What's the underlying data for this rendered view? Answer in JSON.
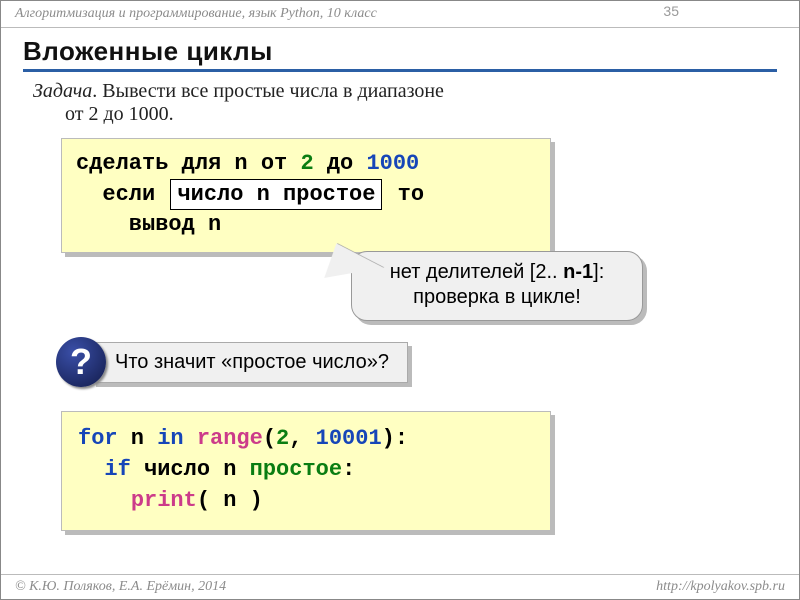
{
  "header": {
    "subject": "Алгоритмизация и программирование, язык Python, 10 класс",
    "page_number": "35"
  },
  "title": "Вложенные циклы",
  "task": {
    "label": "Задача",
    "text_line1": ". Вывести все простые числа в диапазоне",
    "text_line2": "от 2 до 1000."
  },
  "pseudo": {
    "l1_a": "сделать для n от ",
    "l1_b": "2",
    "l1_c": " до ",
    "l1_d": "1000",
    "l2_a": "  если ",
    "l2_box": "число n простое",
    "l2_b": " то",
    "l3": "    вывод n"
  },
  "callout": {
    "line1_a": "нет делителей [2.. ",
    "line1_b": "n-1",
    "line1_c": "]:",
    "line2": "проверка в цикле!"
  },
  "question": {
    "symbol": "?",
    "text": "Что значит «простое число»?"
  },
  "code": {
    "l1_for": "for",
    "l1_mid": " n ",
    "l1_in": "in",
    "l1_sp": " ",
    "l1_range": "range",
    "l1_open": "(",
    "l1_arg1": "2",
    "l1_comma": ", ",
    "l1_arg2": "10001",
    "l1_close": "):",
    "l2_indent": "  ",
    "l2_if": "if",
    "l2_mid": " число n ",
    "l2_prosto": "простое",
    "l2_colon": ":",
    "l3_indent": "    ",
    "l3_print": "print",
    "l3_args": "( n )"
  },
  "footer": {
    "left": "© К.Ю. Поляков, Е.А. Ерёмин, 2014",
    "right": "http://kpolyakov.spb.ru"
  }
}
